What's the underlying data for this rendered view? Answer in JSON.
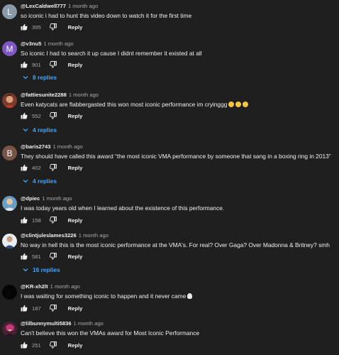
{
  "ui": {
    "reply_label": "Reply"
  },
  "comments": [
    {
      "author": "@LexCaldwell777",
      "time": "1 month ago",
      "text": "so iconic i had to hunt this video down to watch it for the first time",
      "likes": "395",
      "avatar_letter": "L",
      "avatar_color": "#8a9aa6"
    },
    {
      "author": "@v3nu5",
      "time": "1 month ago",
      "text": "So iconic I had to search it up cause I didnt remember it existed at all",
      "likes": "901",
      "avatar_letter": "M",
      "avatar_color": "#7e57c2",
      "replies": "8 replies"
    },
    {
      "author": "@fattiesunite2288",
      "time": "1 month ago",
      "text": "Even katycats are flabbergasted this won most iconic performance im cryinggg",
      "likes": "552",
      "avatar_color": "#7a3a2c",
      "replies": "4 replies",
      "emojis": [
        "crying-face",
        "crying-face",
        "crying-face"
      ]
    },
    {
      "author": "@baris2743",
      "time": "1 month ago",
      "text": "They should have called this award “the most iconic VMA performance by someone that sang in a boxing ring in 2013”",
      "likes": "402",
      "avatar_letter": "B",
      "avatar_color": "#795548",
      "replies": "4 replies"
    },
    {
      "author": "@dpiec",
      "time": "1 month ago",
      "text": "I was today years old when I learned about the existence of this performance.",
      "likes": "158",
      "avatar_color": "#6a9fc4"
    },
    {
      "author": "@clintjuleslames3226",
      "time": "1 month ago",
      "text": "No way in hell this is the most iconic performance at the VMA's. For real? Over Gaga? Over Madonna & Britney? smh",
      "likes": "581",
      "avatar_color": "#e9edf2",
      "replies": "16 replies"
    },
    {
      "author": "@KR-xh2lt",
      "time": "1 month ago",
      "text": "I was waiting for something iconic to happen and it never came",
      "likes": "187",
      "avatar_color": "#050505",
      "emojis": [
        "skull"
      ]
    },
    {
      "author": "@lilbunnymulti5836",
      "time": "1 month ago",
      "text": "Can't believe this won the VMAs award for Most Iconic Performance",
      "likes": "251",
      "avatar_color": "#4a2035"
    }
  ]
}
